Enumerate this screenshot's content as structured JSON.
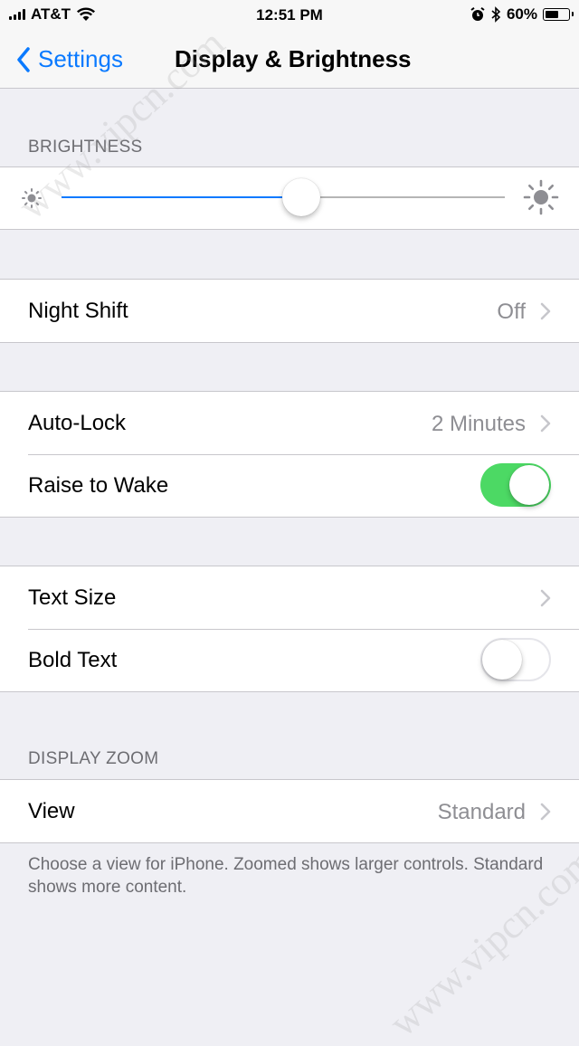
{
  "status_bar": {
    "carrier": "AT&T",
    "time": "12:51 PM",
    "battery_percent": "60%",
    "battery_level": 0.6,
    "icons": [
      "signal-icon",
      "wifi-icon",
      "alarm-icon",
      "bluetooth-icon",
      "battery-icon"
    ]
  },
  "nav": {
    "back_label": "Settings",
    "title": "Display & Brightness"
  },
  "brightness": {
    "header": "BRIGHTNESS",
    "level": 0.54
  },
  "night_shift": {
    "label": "Night Shift",
    "value": "Off"
  },
  "lock": {
    "auto_lock_label": "Auto-Lock",
    "auto_lock_value": "2 Minutes",
    "raise_label": "Raise to Wake",
    "raise_on": true
  },
  "text": {
    "size_label": "Text Size",
    "bold_label": "Bold Text",
    "bold_on": false
  },
  "zoom": {
    "header": "DISPLAY ZOOM",
    "view_label": "View",
    "view_value": "Standard",
    "note": "Choose a view for iPhone. Zoomed shows larger controls. Standard shows more content."
  },
  "watermark": "www.vipcn.com",
  "colors": {
    "accent": "#0a7aff",
    "toggle_on": "#4cd964",
    "background": "#efeff4"
  }
}
